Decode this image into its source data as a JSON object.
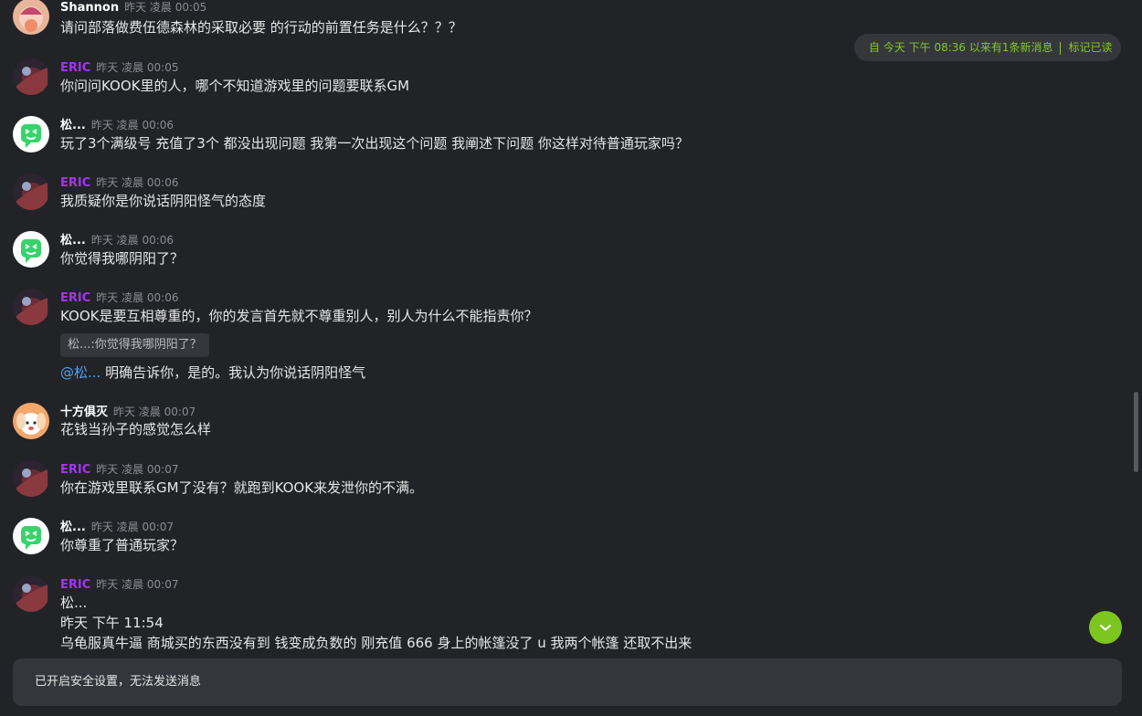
{
  "messages": [
    {
      "user": "Shannon",
      "time": "昨天 凌晨 00:05",
      "text": "请问部落做费伍德森林的采取必要 的行动的前置任务是什么？？？"
    },
    {
      "user": "ERIC",
      "time": "昨天 凌晨 00:05",
      "text": "你问问KOOK里的人，哪个不知道游戏里的问题要联系GM"
    },
    {
      "user": "松...",
      "time": "昨天 凌晨 00:06",
      "text": "玩了3个满级号 充值了3个 都没出现问题 我第一次出现这个问题 我阐述下问题 你这样对待普通玩家吗？"
    },
    {
      "user": "ERIC",
      "time": "昨天 凌晨 00:06",
      "text": "我质疑你是你说话阴阳怪气的态度"
    },
    {
      "user": "松...",
      "time": "昨天 凌晨 00:06",
      "text": "你觉得我哪阴阳了？"
    },
    {
      "user": "ERIC",
      "time": "昨天 凌晨 00:06",
      "text": "KOOK是要互相尊重的，你的发言首先就不尊重别人，别人为什么不能指责你？",
      "quote": "松...:你觉得我哪阴阳了？",
      "mention": "@松...",
      "reply_text": " 明确告诉你，是的。我认为你说话阴阳怪气"
    },
    {
      "user": "十方俱灭",
      "time": "昨天 凌晨 00:07",
      "text": "花钱当孙子的感觉怎么样"
    },
    {
      "user": "ERIC",
      "time": "昨天 凌晨 00:07",
      "text": "你在游戏里联系GM了没有？就跑到KOOK来发泄你的不满。"
    },
    {
      "user": "松...",
      "time": "昨天 凌晨 00:07",
      "text": "你尊重了普通玩家？"
    },
    {
      "user": "ERIC",
      "time": "昨天 凌晨 00:07",
      "lines": [
        "松...",
        "昨天 下午 11:54",
        "乌龟服真牛逼 商城买的东西没有到 钱变成负数的 刚充值 666 身上的帐篷没了 u 我两个帐篷 还取不出来"
      ]
    }
  ],
  "new_banner": {
    "text": "自 今天 下午 08:36 以来有1条新消息",
    "action": "标记已读"
  },
  "input": {
    "status": "已开启安全设置，无法发送消息"
  },
  "colors": {
    "accent": "#7dc61f",
    "mention": "#4ba3f5",
    "eric_name": "#a335ee",
    "background": "#222327"
  },
  "icons": {
    "jump_button": "chevron-down-icon"
  }
}
